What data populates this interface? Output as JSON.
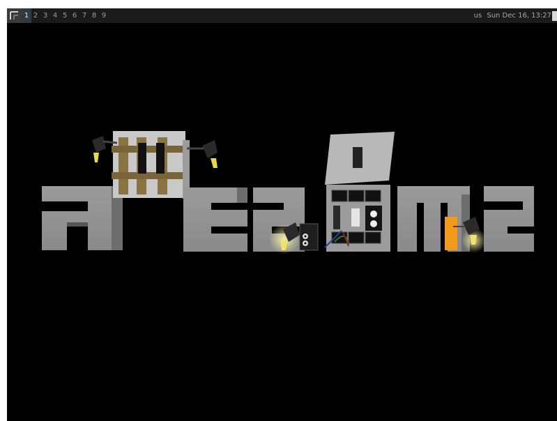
{
  "topbar": {
    "tags": [
      "1",
      "2",
      "3",
      "4",
      "5",
      "6",
      "7",
      "8",
      "9"
    ],
    "active_tag": "1",
    "keyboard_layout": "us",
    "datetime": "Sun Dec 16, 13:27"
  },
  "desktop": {
    "background_color": "#000000",
    "wallpaper_icon": "3d-block-letters-wallpaper"
  }
}
